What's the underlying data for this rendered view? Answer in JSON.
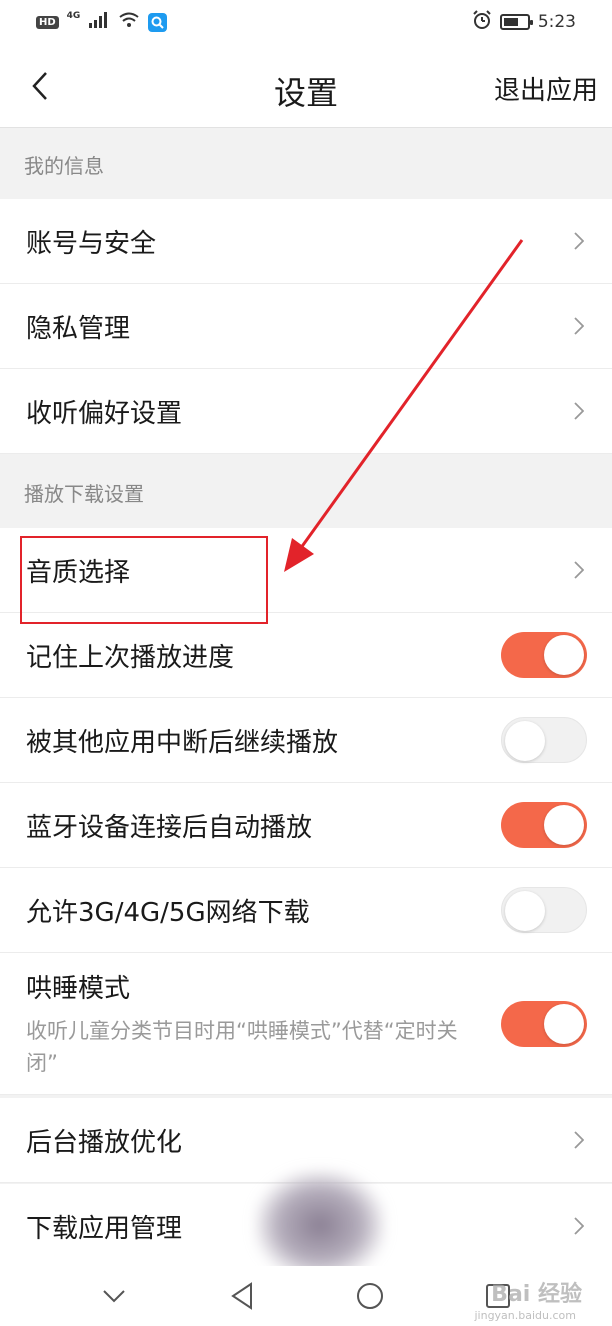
{
  "status_bar": {
    "hd": "HD",
    "network": "4G",
    "time": "5:23",
    "battery_level": 0.55
  },
  "header": {
    "title": "设置",
    "exit_label": "退出应用"
  },
  "sections": [
    {
      "title": "我的信息",
      "items": [
        {
          "label": "账号与安全"
        },
        {
          "label": "隐私管理"
        },
        {
          "label": "收听偏好设置"
        }
      ]
    },
    {
      "title": "播放下载设置",
      "items": [
        {
          "label": "音质选择"
        },
        {
          "label": "记住上次播放进度",
          "toggle": true
        },
        {
          "label": "被其他应用中断后继续播放",
          "toggle": false
        },
        {
          "label": "蓝牙设备连接后自动播放",
          "toggle": true
        },
        {
          "label": "允许3G/4G/5G网络下载",
          "toggle": false
        },
        {
          "label": "哄睡模式",
          "subtitle": "收听儿童分类节目时用“哄睡模式”代替“定时关闭”",
          "toggle": true
        },
        {
          "label": "后台播放优化"
        },
        {
          "label": "下载应用管理"
        }
      ]
    }
  ],
  "colors": {
    "accent": "#f4684a",
    "annotation": "#e2232a"
  },
  "watermark": {
    "text": "Bai 经验",
    "sub": "jingyan.baidu.com"
  }
}
